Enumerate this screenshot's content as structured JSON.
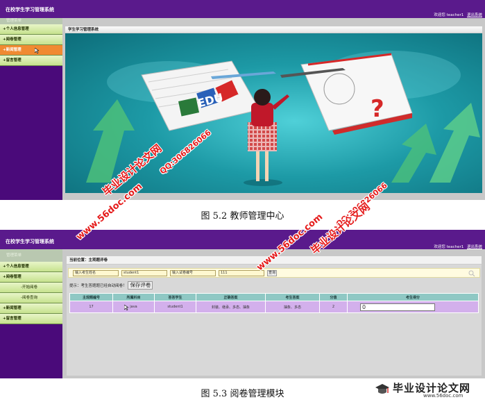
{
  "screen1": {
    "app_title": "在校学生学习管理系统",
    "user_greeting": "欢迎您 teacher1",
    "logout": "退出系统",
    "menu_header": "管理菜单",
    "menu_items": [
      {
        "label": "+个人信息管理",
        "active": false
      },
      {
        "label": "+阅卷管理",
        "active": false
      },
      {
        "label": "+新闻管理",
        "active": true
      },
      {
        "label": "+留言管理",
        "active": false
      }
    ],
    "panel_title": "学生学习管理系统",
    "banner_word": "EDU"
  },
  "caption1": "图 5.2  教师管理中心",
  "screen2": {
    "app_title": "在校学生学习管理系统",
    "user_greeting": "欢迎您 teacher1",
    "logout": "退出系统",
    "menu_header": "管理菜单",
    "menu_items": [
      {
        "label": "+个人信息管理",
        "sub": false
      },
      {
        "label": "+阅卷管理",
        "sub": false
      },
      {
        "label": "-开始阅卷",
        "sub": true
      },
      {
        "label": "-阅卷查询",
        "sub": true
      },
      {
        "label": "+新闻管理",
        "sub": false
      },
      {
        "label": "+留言管理",
        "sub": false
      }
    ],
    "location": "当前位置：主观题评卷",
    "search": {
      "student_label": "输入考生姓名",
      "student_value": "student1",
      "paper_label": "输入试卷编号",
      "paper_value": "111",
      "query_button": "查询"
    },
    "hint": "提示：考生答题题已经自动阅卷！",
    "save_button": "保存评卷",
    "table": {
      "headers": [
        "主观题编号",
        "所属科目",
        "答答学生",
        "正确答案",
        "考生答案",
        "分值",
        "考生得分"
      ],
      "rows": [
        [
          "17",
          "java",
          "student1",
          "封装、继承、多态、抽象",
          "抽象、多态",
          "2",
          "0"
        ]
      ]
    }
  },
  "caption2": "图 5.3  阅卷管理模块",
  "watermarks": {
    "cn_site": "毕业设计论文网",
    "qq": "QQ:306826066",
    "url": "www.56doc.com"
  },
  "footer_logo": {
    "line1": "毕业设计论文网",
    "line2": "www.56doc.com"
  },
  "colors": {
    "topbar": "#5a1a8c",
    "sidebar": "#4a0a7a",
    "menu_green": "#c6e28e",
    "menu_active": "#f08a32",
    "table_header": "#8fc8c4",
    "table_row": "#d3b0ec"
  }
}
